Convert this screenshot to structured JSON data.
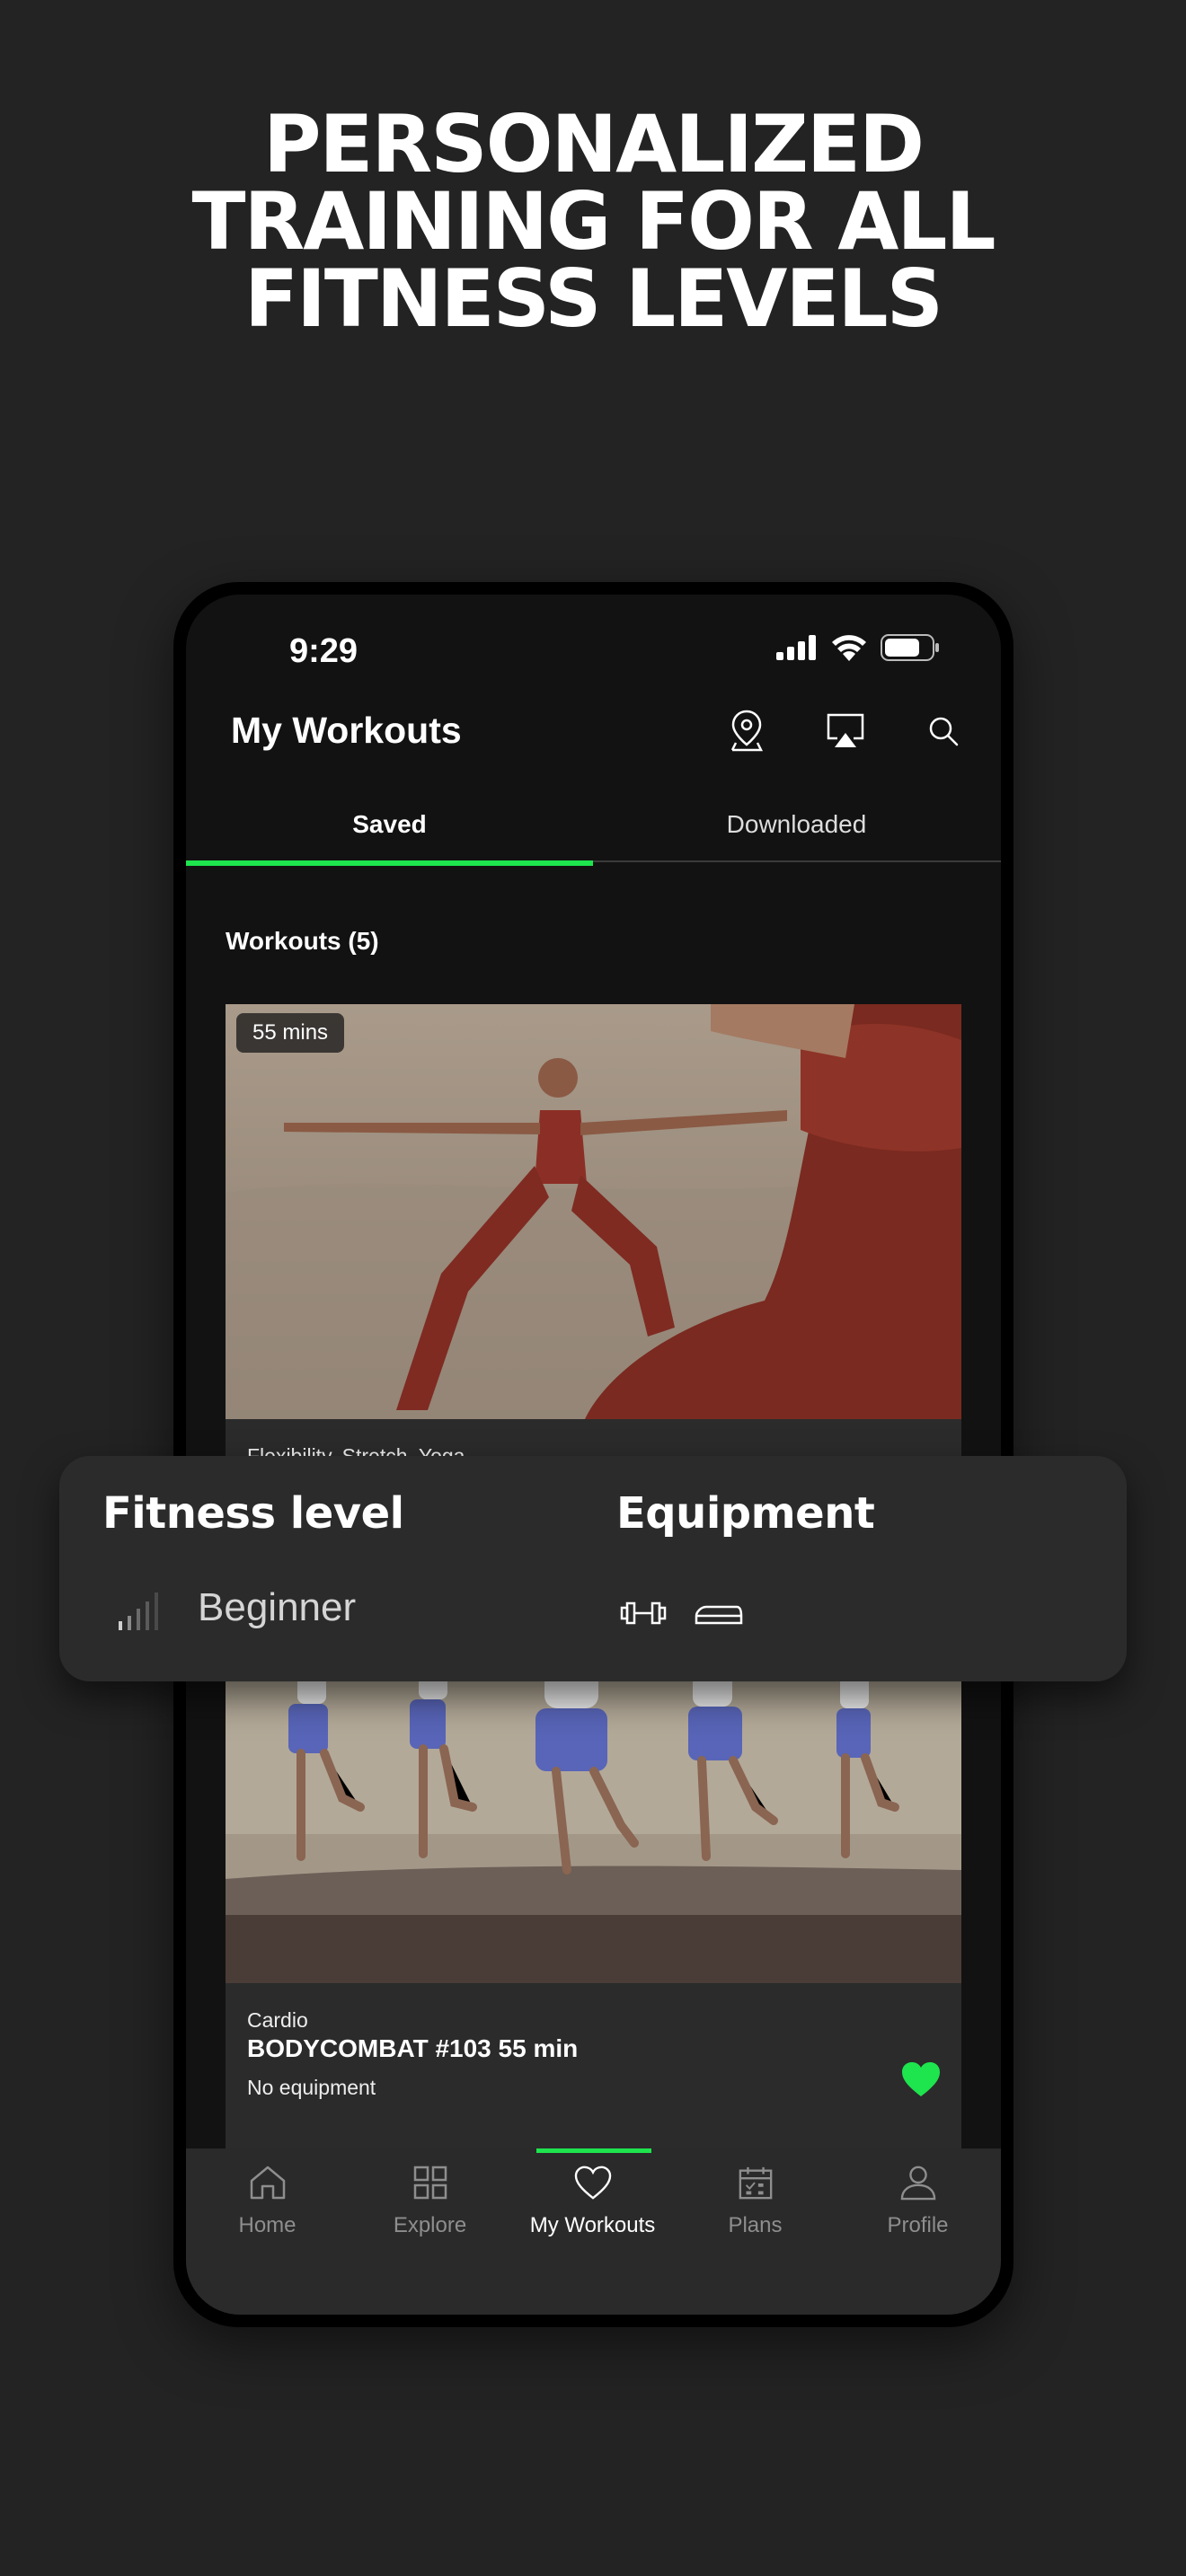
{
  "headline": {
    "line1": "PERSONALIZED",
    "line2": "TRAINING FOR ALL",
    "line3": "FITNESS LEVELS"
  },
  "status_bar": {
    "time": "9:29"
  },
  "header": {
    "title": "My Workouts"
  },
  "tabs": [
    {
      "label": "Saved",
      "active": true
    },
    {
      "label": "Downloaded",
      "active": false
    }
  ],
  "section": {
    "title": "Workouts (5)"
  },
  "workouts": [
    {
      "duration": "55 mins",
      "categories": "Flexibility, Stretch, Yoga"
    },
    {
      "category": "Cardio",
      "name": "BODYCOMBAT #103 55 min",
      "equipment": "No equipment"
    }
  ],
  "overlay": {
    "fitness_level_title": "Fitness level",
    "fitness_level_value": "Beginner",
    "equipment_title": "Equipment",
    "equipment_icons": [
      "dumbbell-icon",
      "step-platform-icon"
    ]
  },
  "nav": [
    {
      "label": "Home",
      "icon": "home-icon",
      "active": false
    },
    {
      "label": "Explore",
      "icon": "grid-icon",
      "active": false
    },
    {
      "label": "My Workouts",
      "icon": "heart-icon",
      "active": true
    },
    {
      "label": "Plans",
      "icon": "calendar-icon",
      "active": false
    },
    {
      "label": "Profile",
      "icon": "user-icon",
      "active": false
    }
  ],
  "colors": {
    "accent": "#1ee44e",
    "background": "#232323",
    "card": "#2b2b2b"
  }
}
